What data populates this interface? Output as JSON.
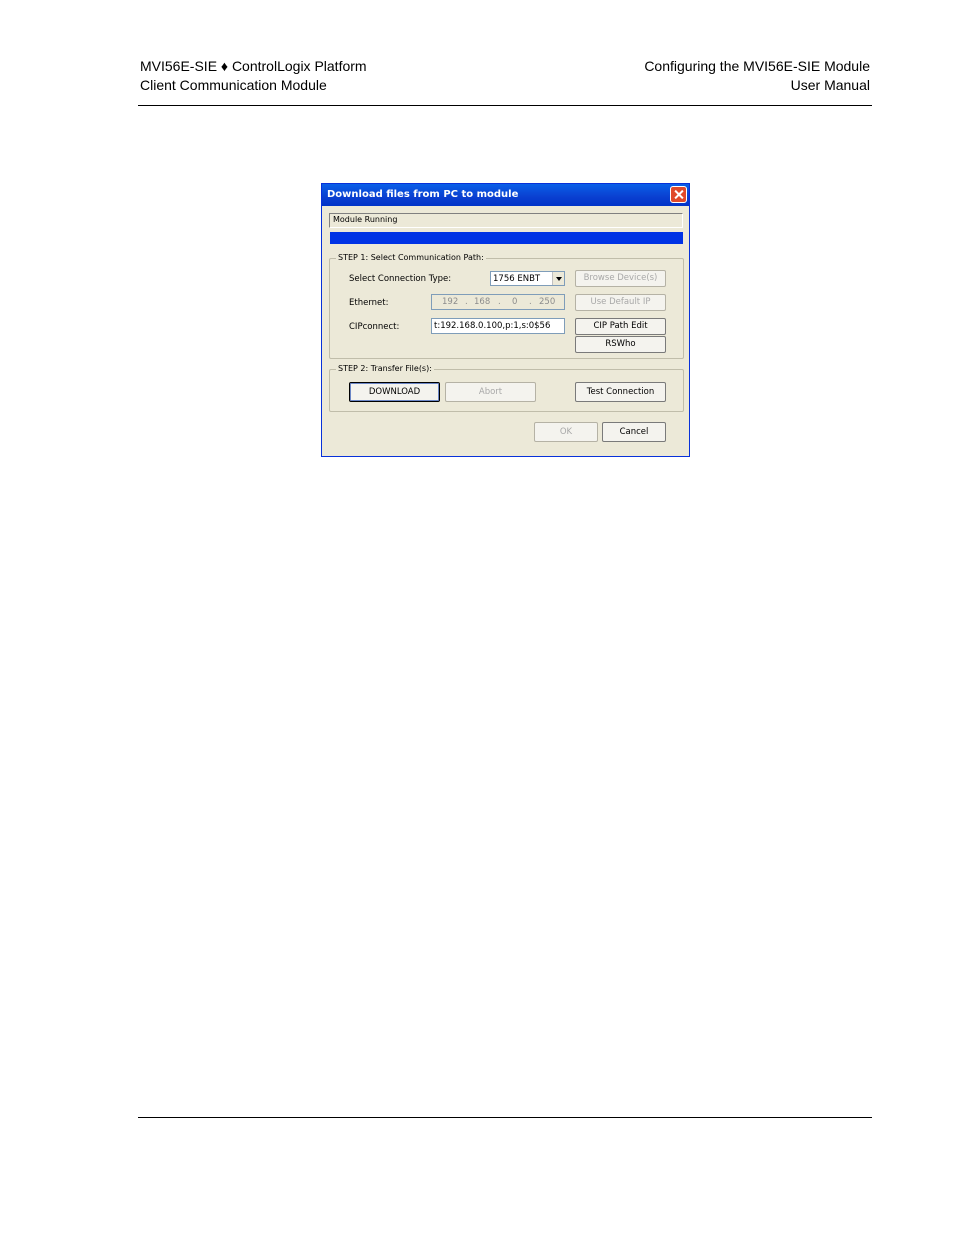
{
  "header": {
    "left_line1": "MVI56E-SIE ♦ ControlLogix Platform",
    "left_line2": "Client Communication Module",
    "right_line1": "Configuring the MVI56E-SIE Module",
    "right_line2": "User Manual"
  },
  "dialog": {
    "title": "Download files from PC to module",
    "status_text": "Module Running",
    "step1": {
      "legend": "STEP 1: Select Communication Path:",
      "connection_type_label": "Select Connection Type:",
      "connection_type_value": "1756 ENBT",
      "browse_label": "Browse Device(s)",
      "ethernet_label": "Ethernet:",
      "ip_octets": [
        "192",
        "168",
        "0",
        "250"
      ],
      "use_default_ip_label": "Use Default IP",
      "cipconnect_label": "CIPconnect:",
      "cipconnect_value": "t:192.168.0.100,p:1,s:0$56",
      "cip_path_edit_label": "CIP Path Edit",
      "rswho_label": "RSWho"
    },
    "step2": {
      "legend": "STEP 2: Transfer File(s):",
      "download_label": "DOWNLOAD",
      "abort_label": "Abort",
      "test_connection_label": "Test Connection"
    },
    "ok_label": "OK",
    "cancel_label": "Cancel"
  }
}
